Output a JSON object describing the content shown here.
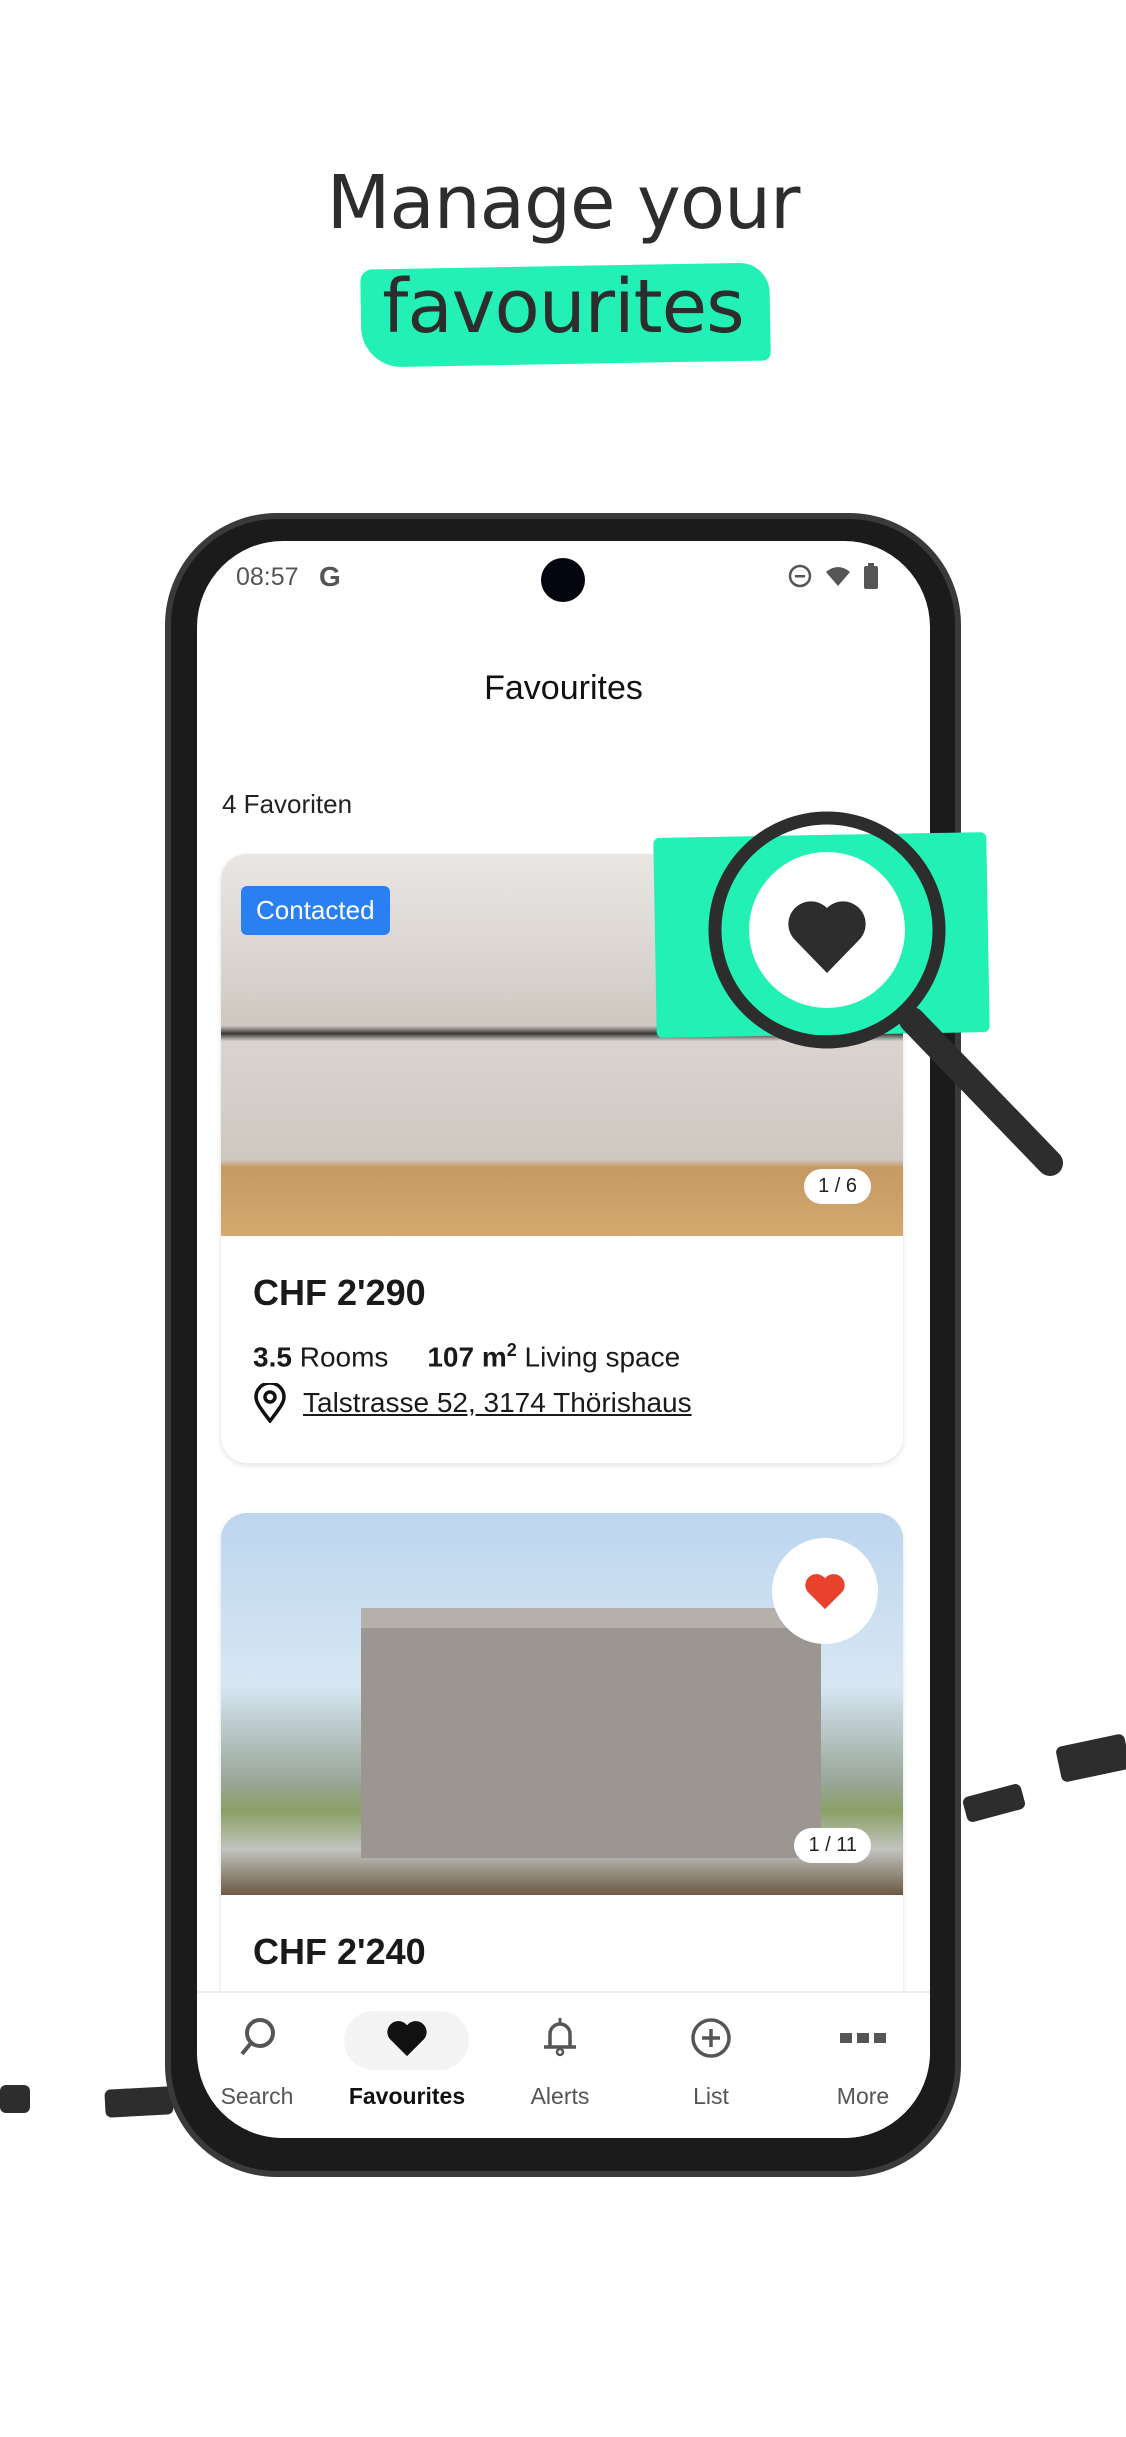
{
  "promo": {
    "line1": "Manage your",
    "line2": "favourites",
    "accent": "#22f0b4"
  },
  "status_bar": {
    "time": "08:57",
    "google_badge": "G",
    "icons": [
      "do-not-disturb-icon",
      "wifi-icon",
      "battery-icon"
    ]
  },
  "header": {
    "title": "Favourites"
  },
  "list": {
    "count_label": "4 Favoriten",
    "cards": [
      {
        "badge": "Contacted",
        "photo_counter": "1 / 6",
        "price": "CHF 2'290",
        "rooms_value": "3.5",
        "rooms_label": "Rooms",
        "area_value": "107 m",
        "area_sup": "2",
        "area_label": "Living space",
        "address": "Talstrasse 52, 3174 Thörishaus",
        "favourited": true
      },
      {
        "photo_counter": "1 / 11",
        "price": "CHF 2'240",
        "favourited": true
      }
    ],
    "badge_color": "#2a80f2",
    "heart_color": "#e8412c"
  },
  "bottom_nav": {
    "items": [
      {
        "label": "Search",
        "icon": "search-icon"
      },
      {
        "label": "Favourites",
        "icon": "heart-icon",
        "active": true
      },
      {
        "label": "Alerts",
        "icon": "bell-icon"
      },
      {
        "label": "List",
        "icon": "plus-circle-icon"
      },
      {
        "label": "More",
        "icon": "more-icon"
      }
    ]
  }
}
